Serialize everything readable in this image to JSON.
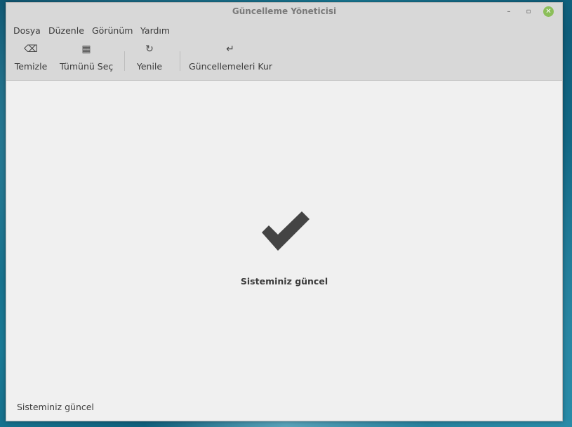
{
  "window": {
    "title": "Güncelleme Yöneticisi",
    "controls": {
      "minimize": "–",
      "maximize": "▫",
      "close": "✕"
    }
  },
  "menubar": {
    "items": [
      {
        "label": "Dosya"
      },
      {
        "label": "Düzenle"
      },
      {
        "label": "Görünüm"
      },
      {
        "label": "Yardım"
      }
    ]
  },
  "toolbar": {
    "clear": {
      "label": "Temizle",
      "icon": "backspace-icon",
      "glyph": "⌫"
    },
    "select_all": {
      "label": "Tümünü Seç",
      "icon": "select-all-icon",
      "glyph": "▦"
    },
    "refresh": {
      "label": "Yenile",
      "icon": "refresh-icon",
      "glyph": "↻"
    },
    "install": {
      "label": "Güncellemeleri Kur",
      "icon": "enter-icon",
      "glyph": "↵"
    }
  },
  "main": {
    "icon": "checkmark-icon",
    "message": "Sisteminiz güncel"
  },
  "statusbar": {
    "text": "Sisteminiz güncel"
  },
  "colors": {
    "chrome": "#d8d8d8",
    "content": "#f0f0f0",
    "close_button": "#8cbf5a",
    "icon": "#444444"
  }
}
